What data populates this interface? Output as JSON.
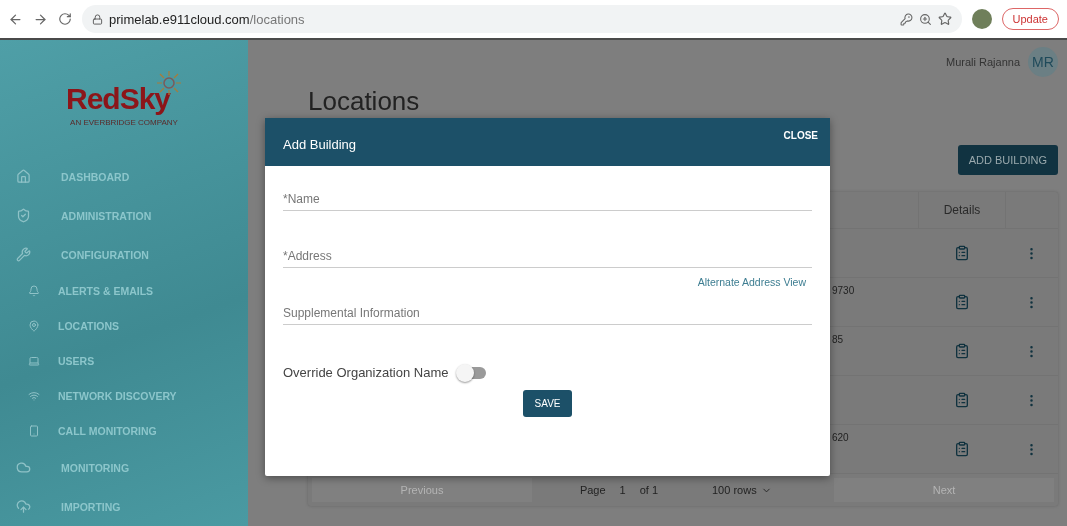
{
  "browser": {
    "url_host": "primelab.e911cloud.com",
    "url_path": "/locations",
    "update_button": "Update"
  },
  "sidebar": {
    "logo": "RedSky",
    "tagline": "AN EVERBRIDGE COMPANY",
    "items": [
      {
        "label": "DASHBOARD"
      },
      {
        "label": "ADMINISTRATION"
      },
      {
        "label": "CONFIGURATION",
        "children": [
          {
            "label": "ALERTS & EMAILS"
          },
          {
            "label": "LOCATIONS"
          },
          {
            "label": "USERS"
          },
          {
            "label": "NETWORK DISCOVERY"
          },
          {
            "label": "CALL MONITORING"
          }
        ]
      },
      {
        "label": "MONITORING"
      },
      {
        "label": "IMPORTING"
      }
    ]
  },
  "user": {
    "name": "Murali Rajanna",
    "initials": "MR"
  },
  "page_title": "Locations",
  "add_button": "ADD BUILDING",
  "table": {
    "columns": [
      "Details"
    ],
    "rows": [
      {
        "kind": "plain"
      },
      {
        "kind": "fragment",
        "fragment": "9730"
      },
      {
        "kind": "fragment",
        "fragment": "85"
      },
      {
        "kind": "plain"
      },
      {
        "kind": "fragment",
        "fragment": "620"
      }
    ]
  },
  "pagination": {
    "previous": {
      "label": "Previous",
      "disabled": true
    },
    "page_label": "Page",
    "page": "1",
    "of": "of 1",
    "rows": "100 rows",
    "next": {
      "label": "Next",
      "disabled": true
    }
  },
  "modal": {
    "title": "Add Building",
    "close": "CLOSE",
    "fields": [
      {
        "placeholder": "*Name"
      },
      {
        "placeholder": "*Address"
      },
      {
        "placeholder": "Supplemental Information"
      }
    ],
    "alt_link": "Alternate Address View",
    "toggle": {
      "label": "Override Organization Name",
      "on": false
    },
    "save": "SAVE"
  }
}
